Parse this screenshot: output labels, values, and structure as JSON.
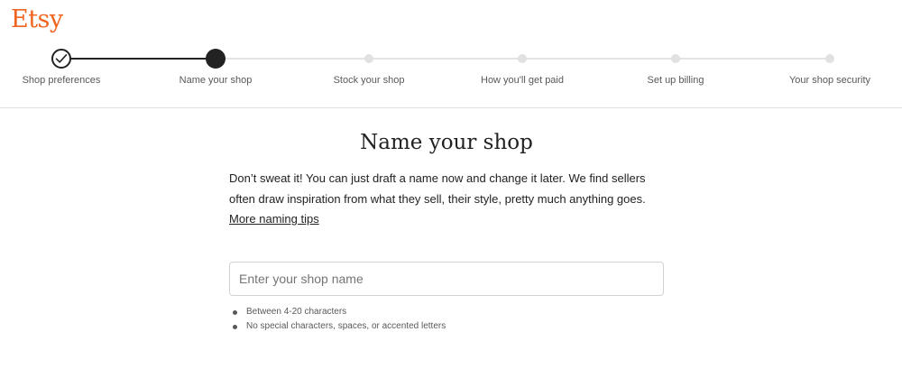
{
  "brand": {
    "logo_text": "Etsy",
    "accent_color": "#f1641e"
  },
  "stepper": {
    "current_index": 1,
    "steps": [
      {
        "label": "Shop preferences",
        "status": "complete",
        "icon": "check-icon"
      },
      {
        "label": "Name your shop",
        "status": "current"
      },
      {
        "label": "Stock your shop",
        "status": "pending"
      },
      {
        "label": "How you'll get paid",
        "status": "pending"
      },
      {
        "label": "Set up billing",
        "status": "pending"
      },
      {
        "label": "Your shop security",
        "status": "pending"
      }
    ]
  },
  "main": {
    "title": "Name your shop",
    "intro_text": "Don’t sweat it! You can just draft a name now and change it later. We find sellers often draw inspiration from what they sell, their style, pretty much anything goes. ",
    "tips_link": "More naming tips",
    "shop_name_input": {
      "value": "",
      "placeholder": "Enter your shop name"
    },
    "requirements": [
      "Between 4-20 characters",
      "No special characters, spaces, or accented letters"
    ]
  }
}
